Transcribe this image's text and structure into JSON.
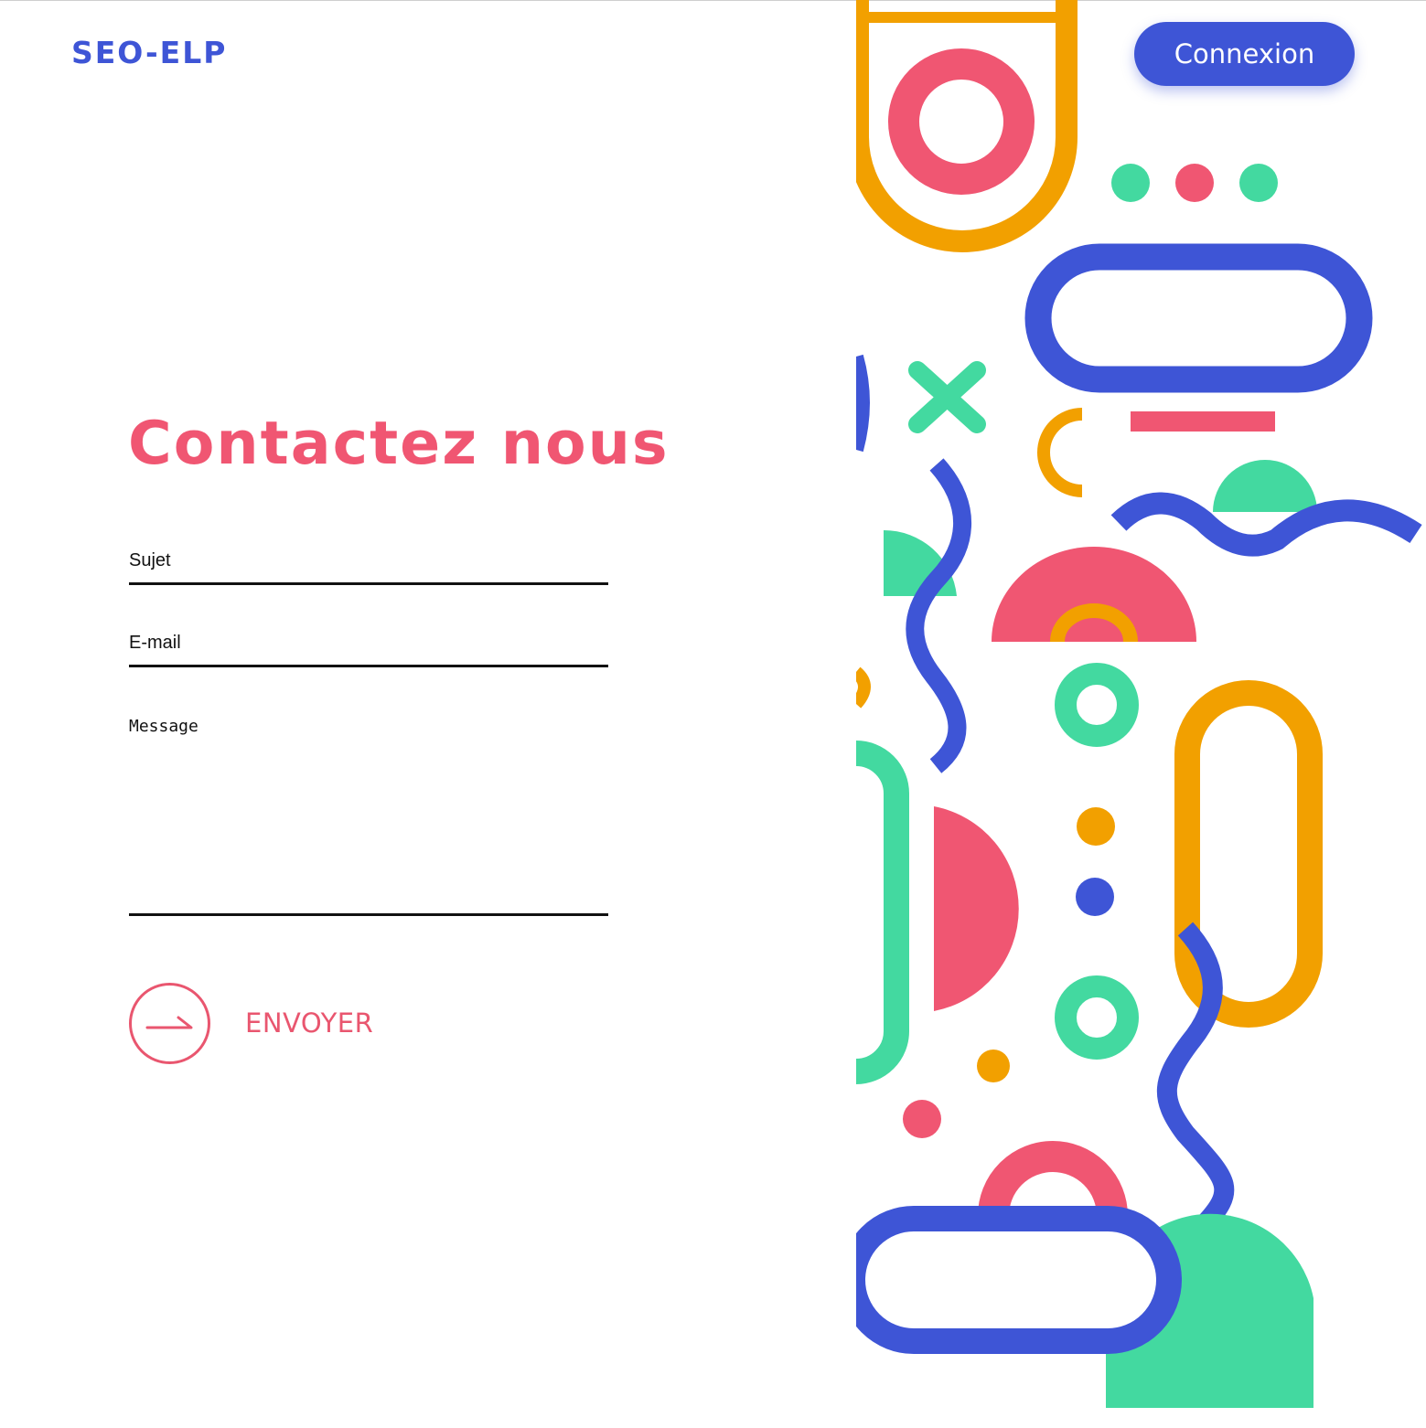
{
  "header": {
    "logo": "SEO-ELP",
    "login_label": "Connexion"
  },
  "main": {
    "title": "Contactez nous",
    "form": {
      "subject_placeholder": "Sujet",
      "email_placeholder": "E-mail",
      "message_placeholder": "Message",
      "submit_label": "ENVOYER"
    }
  },
  "colors": {
    "brand_blue": "#3e55d6",
    "accent_pink": "#f05672",
    "green": "#43d9a0",
    "orange": "#f2a000",
    "text": "#111111",
    "background": "#ffffff"
  },
  "icons": {
    "submit": "arrow-right-icon"
  }
}
